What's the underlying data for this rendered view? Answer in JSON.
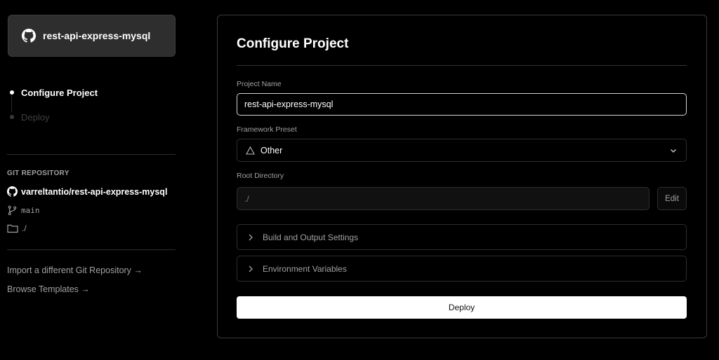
{
  "sidebar": {
    "repo_card_title": "rest-api-express-mysql",
    "steps": [
      {
        "label": "Configure Project",
        "state": "active"
      },
      {
        "label": "Deploy",
        "state": "inactive"
      }
    ],
    "git_header": "GIT REPOSITORY",
    "repo_full_name": "varreltantio/rest-api-express-mysql",
    "branch": "main",
    "directory": "./",
    "links": [
      {
        "label": "Import a different Git Repository →"
      },
      {
        "label": "Browse Templates →"
      }
    ]
  },
  "main": {
    "title": "Configure Project",
    "project_name": {
      "label": "Project Name",
      "value": "rest-api-express-mysql"
    },
    "framework": {
      "label": "Framework Preset",
      "value": "Other",
      "icon": "triangle-icon"
    },
    "root_directory": {
      "label": "Root Directory",
      "value": "./",
      "edit_label": "Edit"
    },
    "accordions": [
      {
        "label": "Build and Output Settings"
      },
      {
        "label": "Environment Variables"
      }
    ],
    "deploy_label": "Deploy"
  },
  "colors": {
    "background": "#000000",
    "card": "#2e2e2e",
    "border": "#2e2e2e",
    "text_primary": "#ffffff",
    "text_muted": "#a1a1a1",
    "button_bg": "#ffffff"
  }
}
